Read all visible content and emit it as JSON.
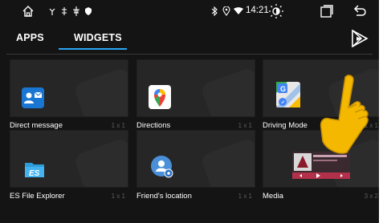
{
  "statusbar": {
    "icons_left": [
      "home-icon",
      "usb-icon",
      "usb-icon",
      "usb-icon",
      "shield-icon"
    ],
    "icons_right": [
      "bluetooth-icon",
      "location-icon",
      "wifi-icon"
    ],
    "time": "14:21",
    "action_icons": [
      "brightness-icon",
      "recent-apps-icon",
      "back-icon"
    ]
  },
  "tabs": [
    {
      "label": "APPS",
      "active": false
    },
    {
      "label": "WIDGETS",
      "active": true
    }
  ],
  "accent": "#2aa7f5",
  "widgets": [
    {
      "label": "Direct message",
      "size": "1 x 1",
      "icon": "direct-message-icon"
    },
    {
      "label": "Directions",
      "size": "1 x 1",
      "icon": "google-maps-icon"
    },
    {
      "label": "Driving Mode",
      "size": "1 x 1",
      "icon": "driving-mode-icon"
    },
    {
      "label": "ES File Explorer",
      "size": "1 x 1",
      "icon": "es-file-explorer-icon"
    },
    {
      "label": "Friend's location",
      "size": "1 x 1",
      "icon": "friends-location-icon"
    },
    {
      "label": "Media",
      "size": "3 x 2",
      "icon": "media-player-icon"
    }
  ]
}
